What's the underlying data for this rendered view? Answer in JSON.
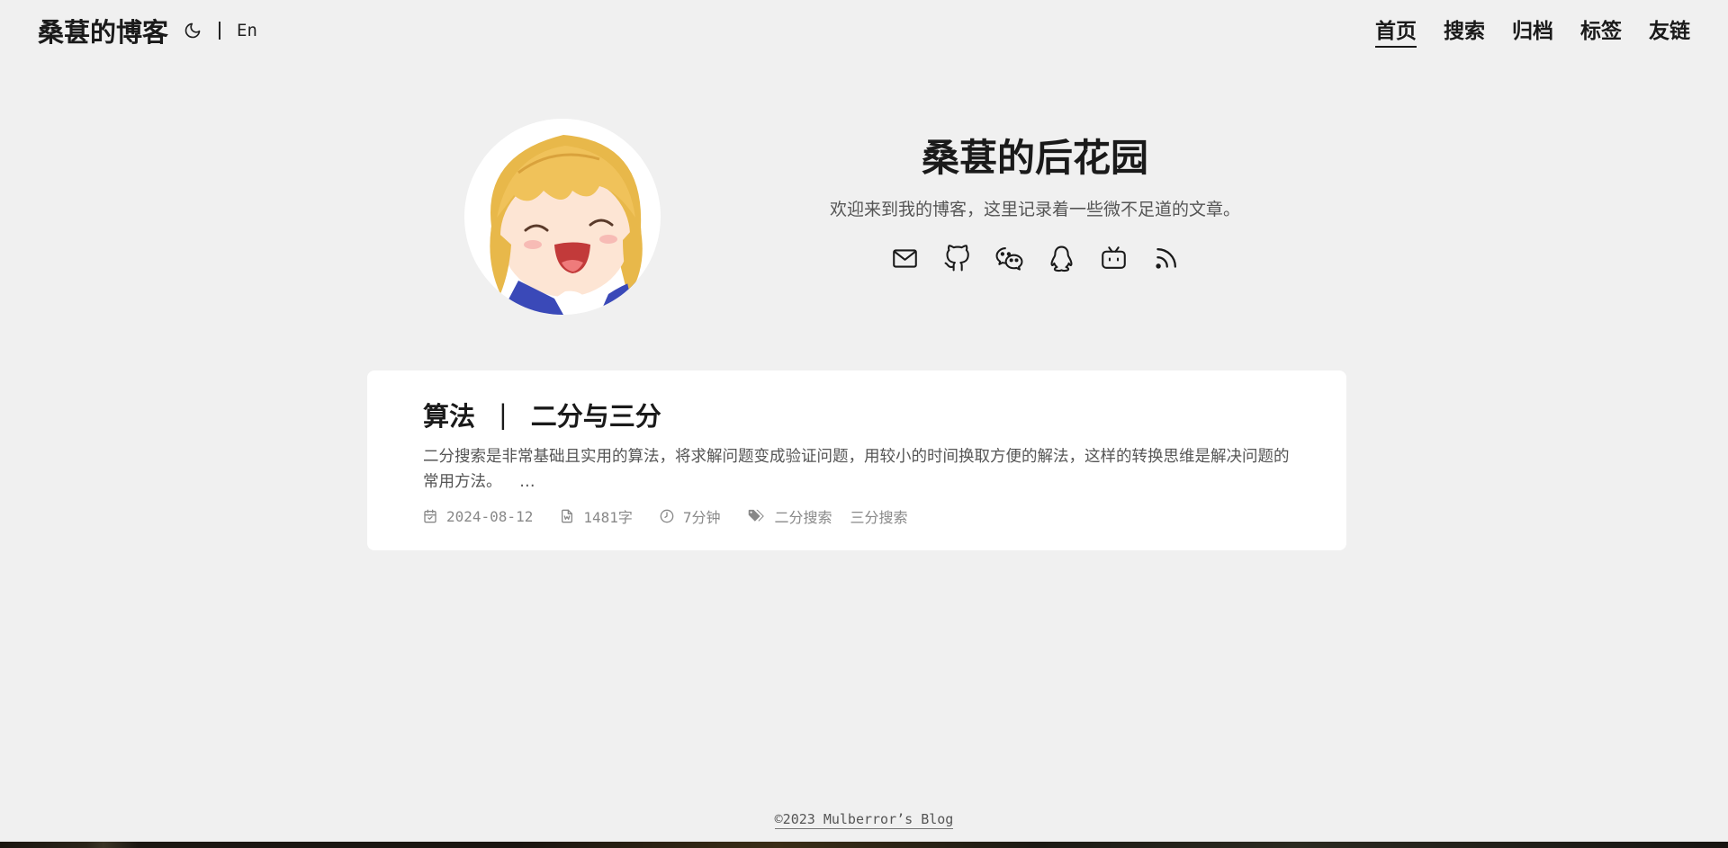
{
  "header": {
    "site_title": "桑葚的博客",
    "lang_label": "En",
    "nav": [
      {
        "label": "首页",
        "active": true
      },
      {
        "label": "搜索",
        "active": false
      },
      {
        "label": "归档",
        "active": false
      },
      {
        "label": "标签",
        "active": false
      },
      {
        "label": "友链",
        "active": false
      }
    ]
  },
  "profile": {
    "title": "桑葚的后花园",
    "subtitle": "欢迎来到我的博客，这里记录着一些微不足道的文章。",
    "social_icons": [
      "mail-icon",
      "github-icon",
      "wechat-icon",
      "qq-icon",
      "bilibili-icon",
      "rss-icon"
    ]
  },
  "post": {
    "category": "算法",
    "separator": "|",
    "title": "二分与三分",
    "excerpt_line1": "二分搜索是非常基础且实用的算法，将求解问题变成验证问题，用较小的时间换取方便的解法，这样的转换思维是解决问题的",
    "excerpt_line2": "常用方法。",
    "ellipsis": "…",
    "date": "2024-08-12",
    "words": "1481字",
    "read_time": "7分钟",
    "tags": [
      "二分搜索",
      "三分搜索"
    ]
  },
  "footer": {
    "text": "©2023 Mulberror’s Blog"
  }
}
